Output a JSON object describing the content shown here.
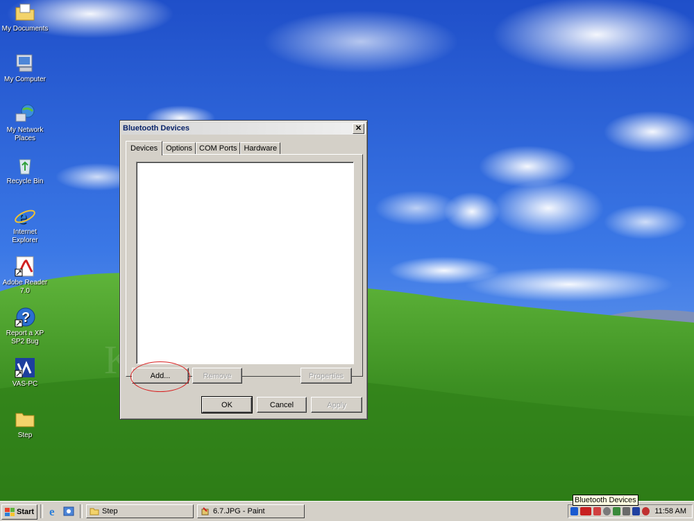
{
  "desktop": {
    "icons": [
      {
        "label": "My Documents",
        "icon": "folder-documents-icon"
      },
      {
        "label": "My Computer",
        "icon": "computer-icon"
      },
      {
        "label": "My Network Places",
        "icon": "network-icon"
      },
      {
        "label": "Recycle Bin",
        "icon": "recycle-bin-icon"
      },
      {
        "label": "Internet Explorer",
        "icon": "internet-explorer-icon"
      },
      {
        "label": "Adobe Reader 7.0",
        "icon": "adobe-reader-icon"
      },
      {
        "label": "Report a XP SP2 Bug",
        "icon": "help-icon"
      },
      {
        "label": "VAS-PC",
        "icon": "vas-pc-icon"
      },
      {
        "label": "Step",
        "icon": "folder-icon"
      }
    ],
    "watermark": "Kingbolen"
  },
  "dialog": {
    "title": "Bluetooth Devices",
    "tabs": [
      "Devices",
      "Options",
      "COM Ports",
      "Hardware"
    ],
    "active_tab": "Devices",
    "buttons": {
      "add": "Add...",
      "remove": "Remove",
      "properties": "Properties",
      "ok": "OK",
      "cancel": "Cancel",
      "apply": "Apply"
    }
  },
  "taskbar": {
    "start_label": "Start",
    "tasks": [
      {
        "label": "Step",
        "icon": "folder-icon"
      },
      {
        "label": "6.7.JPG - Paint",
        "icon": "paint-icon"
      }
    ],
    "tooltip": "Bluetooth Devices",
    "clock": "11:58 AM"
  },
  "colors": {
    "sky": "#2f62d6",
    "grass": "#3f9a2a",
    "highlight_ring": "#d82020",
    "dialog_face": "#d4d0c8"
  }
}
